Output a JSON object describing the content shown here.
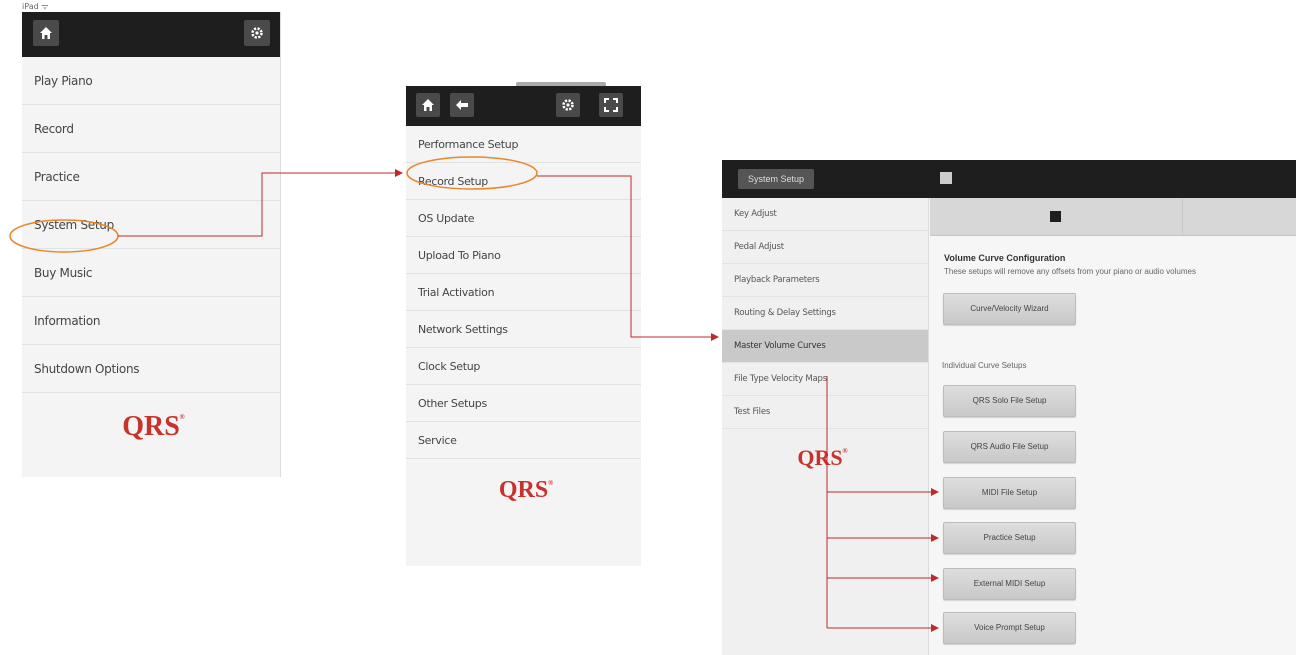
{
  "status_bar": {
    "text": "iPad ᯤ"
  },
  "main_menu": {
    "items": [
      {
        "label": "Play Piano"
      },
      {
        "label": "Record"
      },
      {
        "label": "Practice"
      },
      {
        "label": "System Setup"
      },
      {
        "label": "Buy Music"
      },
      {
        "label": "Information"
      },
      {
        "label": "Shutdown Options"
      }
    ],
    "logo": "QRS"
  },
  "system_setup_menu": {
    "items": [
      {
        "label": "Performance Setup"
      },
      {
        "label": "Record Setup"
      },
      {
        "label": "OS Update"
      },
      {
        "label": "Upload To Piano"
      },
      {
        "label": "Trial Activation"
      },
      {
        "label": "Network Settings"
      },
      {
        "label": "Clock Setup"
      },
      {
        "label": "Other Setups"
      },
      {
        "label": "Service"
      }
    ],
    "logo": "QRS"
  },
  "detail_panel": {
    "header_title": "System Setup",
    "sidebar": {
      "items": [
        {
          "label": "Key Adjust"
        },
        {
          "label": "Pedal Adjust"
        },
        {
          "label": "Playback Parameters"
        },
        {
          "label": "Routing & Delay Settings"
        },
        {
          "label": "Master Volume Curves"
        },
        {
          "label": "File Type Velocity Maps"
        },
        {
          "label": "Test Files"
        }
      ],
      "active_item": "Master Volume Curves",
      "logo": "QRS"
    },
    "volume_curve_title": "Volume Curve Configuration",
    "volume_curve_desc": "These setups will remove any offsets from your piano or audio volumes",
    "wizard_button": "Curve/Velocity Wizard",
    "individual_label": "Individual Curve Setups",
    "buttons": [
      {
        "label": "QRS Solo File Setup"
      },
      {
        "label": "QRS Audio File Setup"
      },
      {
        "label": "MIDI File Setup"
      },
      {
        "label": "Practice Setup"
      },
      {
        "label": "External MIDI Setup"
      },
      {
        "label": "Voice Prompt Setup"
      }
    ]
  },
  "colors": {
    "accent_red": "#c8322b",
    "topbar": "#1e1e1e",
    "highlight_orange": "#e8862a"
  }
}
